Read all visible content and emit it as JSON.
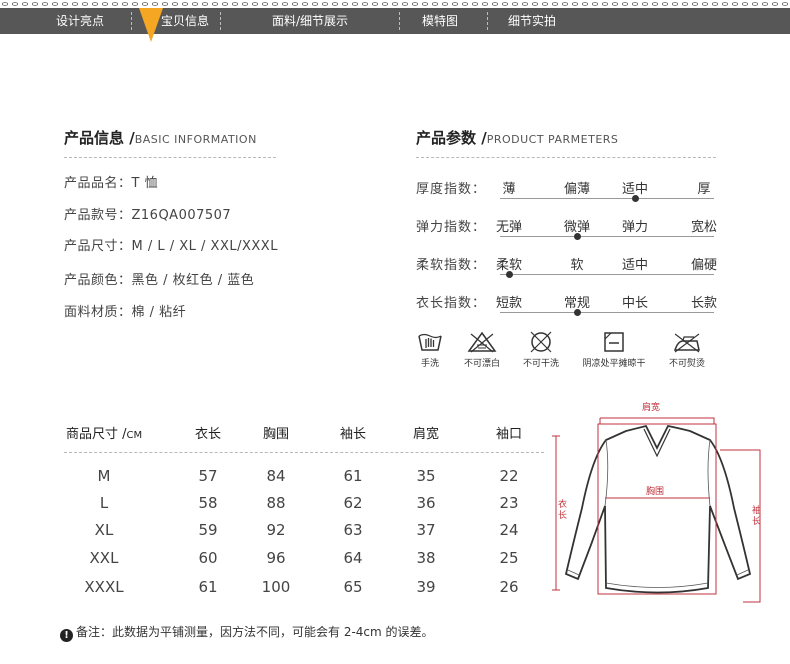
{
  "nav": {
    "items": [
      {
        "label": "设计亮点",
        "active": false
      },
      {
        "label": "宝贝信息",
        "active": true
      },
      {
        "label": "面料/细节展示",
        "active": false
      },
      {
        "label": "模特图",
        "active": false
      },
      {
        "label": "细节实拍",
        "active": false
      }
    ]
  },
  "info": {
    "title": "产品信息 /",
    "title_en": "BASIC INFORMATION",
    "lines": [
      "产品品名：T 恤",
      "产品款号：Z16QA007507",
      "产品尺寸：M / L / XL / XXL/XXXL",
      "产品颜色：黑色 / 枚红色 / 蓝色",
      "面料材质：棉 / 粘纤"
    ]
  },
  "params": {
    "title": "产品参数 /",
    "title_en": "PRODUCT PARMETERS",
    "rows": [
      {
        "label": "厚度指数：",
        "options": [
          "薄",
          "偏薄",
          "适中",
          "厚"
        ],
        "selected": 2
      },
      {
        "label": "弹力指数：",
        "options": [
          "无弹",
          "微弹",
          "弹力",
          "宽松"
        ],
        "selected": 1
      },
      {
        "label": "柔软指数：",
        "options": [
          "柔软",
          "软",
          "适中",
          "偏硬"
        ],
        "selected": 0
      },
      {
        "label": "衣长指数：",
        "options": [
          "短款",
          "常规",
          "中长",
          "长款"
        ],
        "selected": 1
      }
    ]
  },
  "care": [
    {
      "icon": "hand-wash-icon",
      "label": "手洗"
    },
    {
      "icon": "no-bleach-icon",
      "label": "不可漂白"
    },
    {
      "icon": "no-dry-clean-icon",
      "label": "不可干洗"
    },
    {
      "icon": "flat-dry-shade-icon",
      "label": "阴凉处平摊晾干"
    },
    {
      "icon": "no-iron-icon",
      "label": "不可熨烫"
    }
  ],
  "size_table": {
    "size_header": "商品尺寸 /",
    "unit": "CM",
    "headers": [
      "衣长",
      "胸围",
      "袖长",
      "肩宽",
      "袖口"
    ],
    "rows": [
      {
        "size": "M",
        "values": [
          "57",
          "84",
          "61",
          "35",
          "22"
        ]
      },
      {
        "size": "L",
        "values": [
          "58",
          "88",
          "62",
          "36",
          "23"
        ]
      },
      {
        "size": "XL",
        "values": [
          "59",
          "92",
          "63",
          "37",
          "24"
        ]
      },
      {
        "size": "XXL",
        "values": [
          "60",
          "96",
          "64",
          "38",
          "25"
        ]
      },
      {
        "size": "XXXL",
        "values": [
          "61",
          "100",
          "65",
          "39",
          "26"
        ]
      }
    ]
  },
  "diagram": {
    "shoulder": "肩宽",
    "chest": "胸围",
    "length": "衣长",
    "sleeve": "袖长",
    "accent_color": "#c0323c"
  },
  "note": {
    "icon": "exclamation-icon",
    "text": "备注：此数据为平铺测量，因方法不同，可能会有 2-4cm 的误差。"
  }
}
